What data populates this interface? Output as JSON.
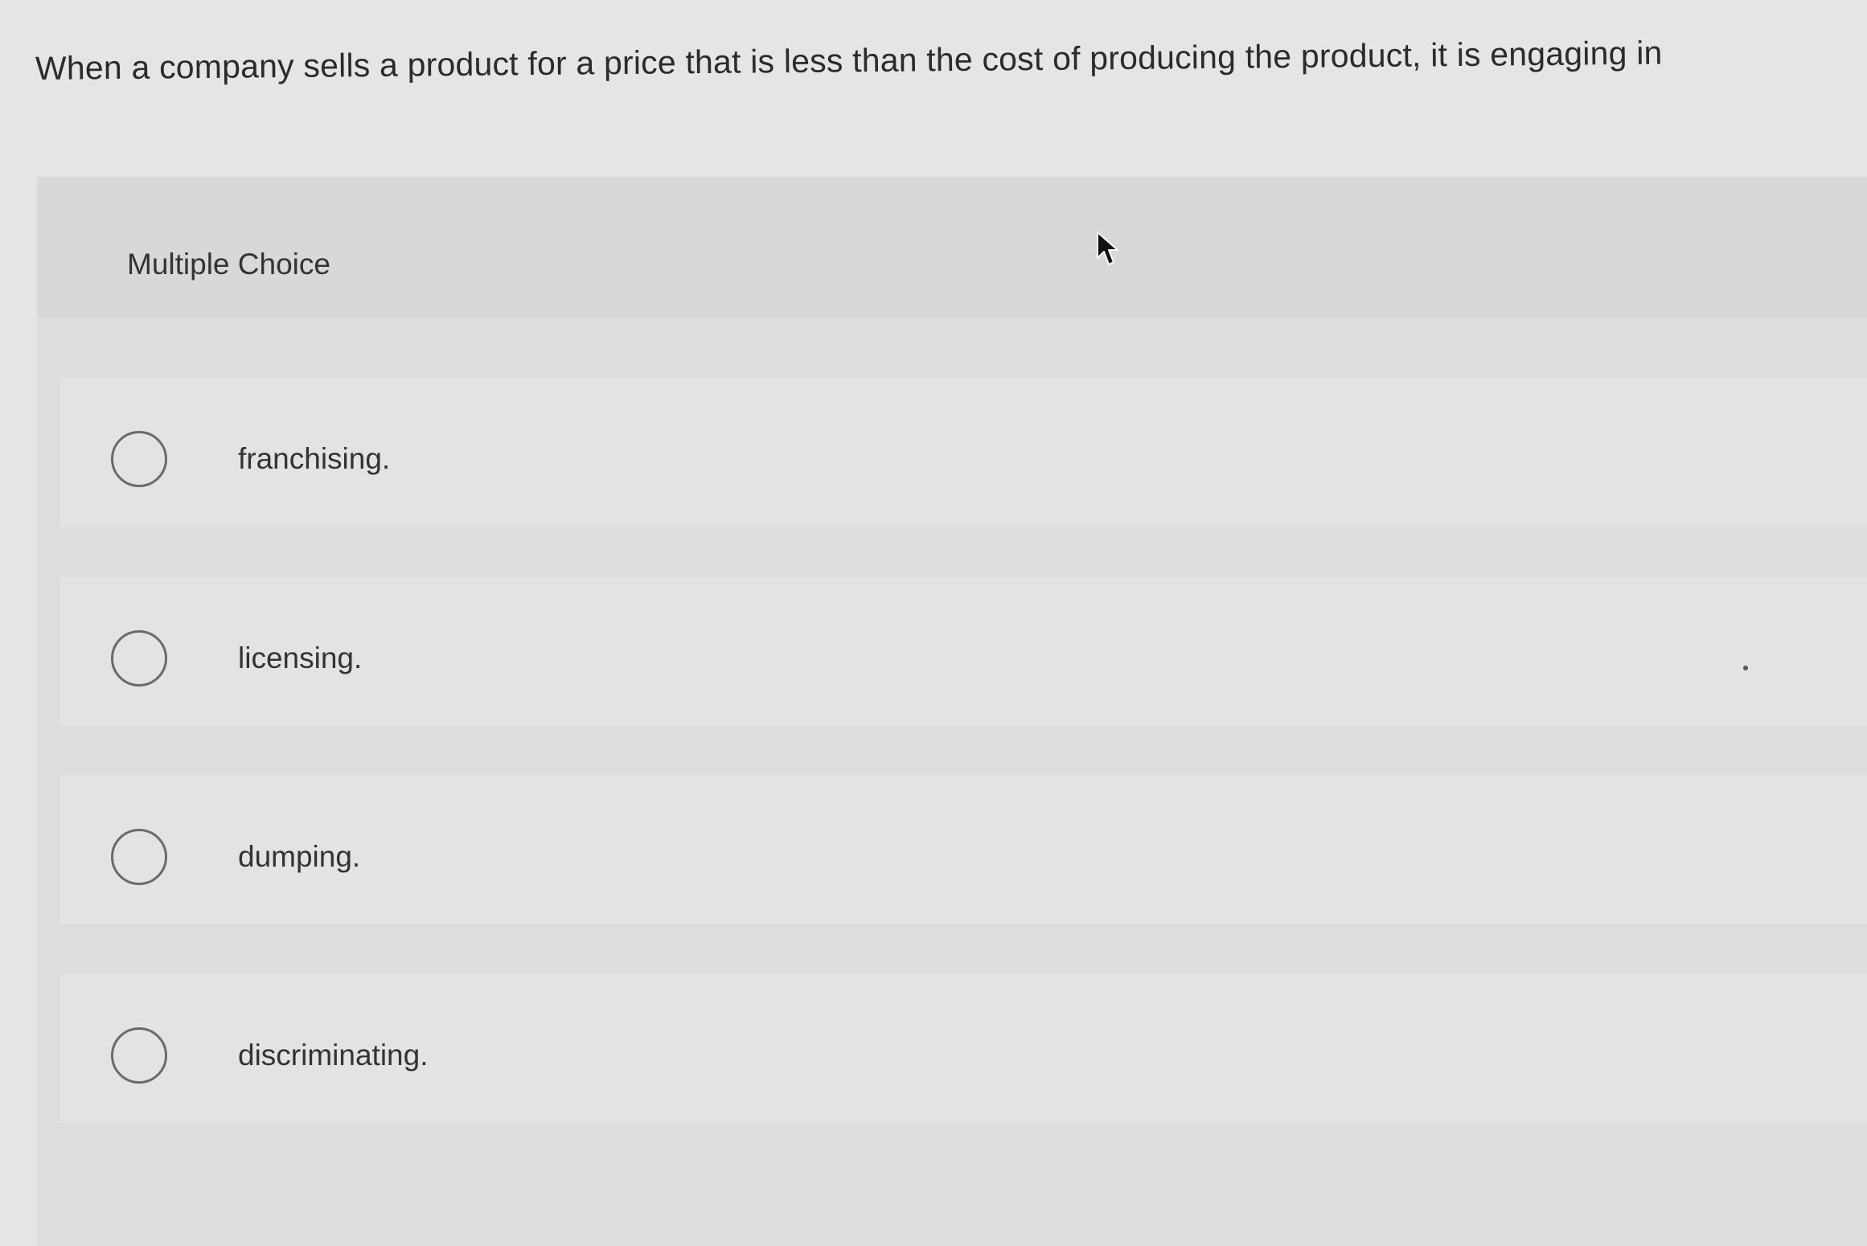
{
  "question": {
    "text": "When a company sells a product for a price that is less than the cost of producing the product, it is engaging in"
  },
  "panel": {
    "title": "Multiple Choice"
  },
  "options": [
    {
      "label": "franchising."
    },
    {
      "label": "licensing."
    },
    {
      "label": "dumping."
    },
    {
      "label": "discriminating."
    }
  ],
  "icons": {
    "cursor": "mouse-pointer-icon",
    "radio": "radio-unselected-icon"
  },
  "colors": {
    "background": "#e6e5e3",
    "panel": "#dedddb",
    "radio_border": "#6a6a6a"
  }
}
